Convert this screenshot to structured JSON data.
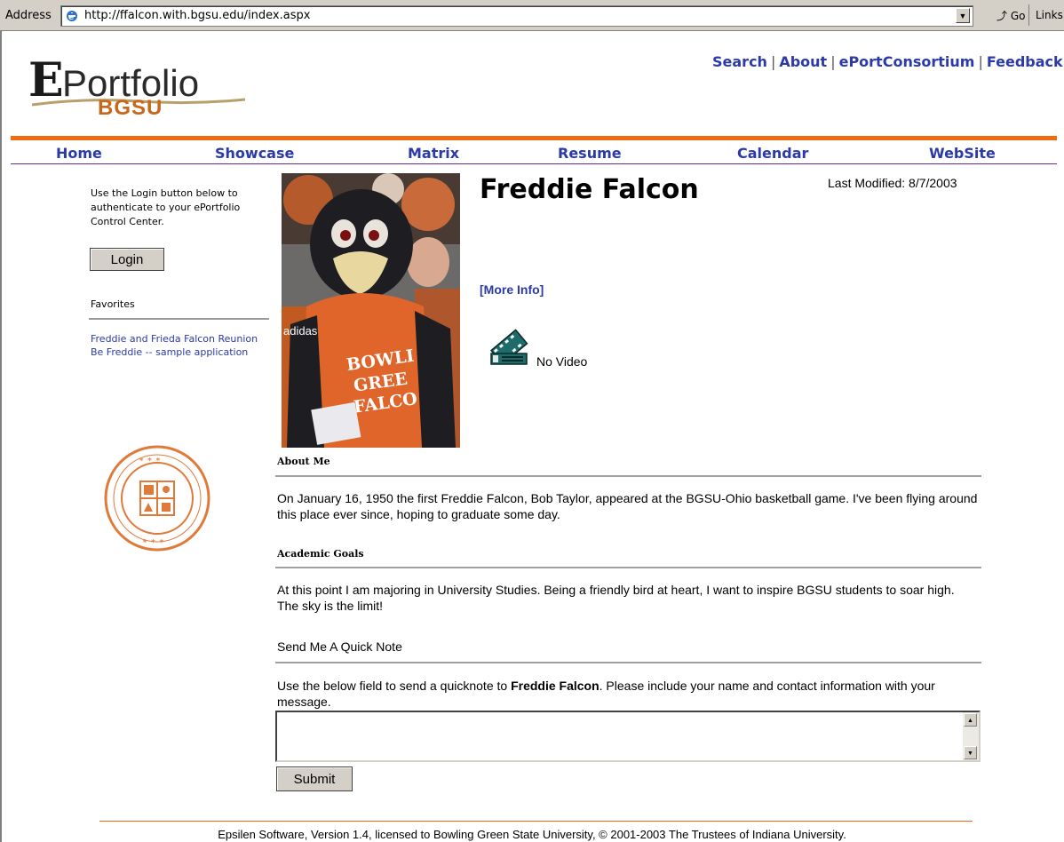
{
  "browser": {
    "address_label": "Address",
    "url": "http://ffalcon.with.bgsu.edu/index.aspx",
    "go_label": "Go",
    "links_label": "Links"
  },
  "logo": {
    "letter": "E",
    "word": "Portfolio",
    "school": "BGSU"
  },
  "top_links": [
    "Search",
    "About",
    "ePortConsortium",
    "Feedback"
  ],
  "top_links_separator": "|",
  "nav": [
    "Home",
    "Showcase",
    "Matrix",
    "Resume",
    "Calendar",
    "WebSite"
  ],
  "sidebar": {
    "login_text": "Use the Login button below to authenticate to your ePortfolio Control Center.",
    "login_button": "Login",
    "favorites_title": "Favorites",
    "favorites": [
      "Freddie and Frieda Falcon Reunion",
      "Be Freddie -- sample application"
    ]
  },
  "profile": {
    "name": "Freddie Falcon",
    "last_modified": "Last Modified: 8/7/2003",
    "more_info": "[More Info]",
    "video_status": "No Video"
  },
  "sections": {
    "about_title": "About Me",
    "about_body": "On January 16, 1950 the first Freddie Falcon, Bob Taylor, appeared at the BGSU-Ohio basketball game. I've been flying around this place ever since, hoping to graduate some day.",
    "goals_title": "Academic Goals",
    "goals_body": "At this point I am majoring in University Studies. Being a friendly bird at heart, I want to inspire BGSU students to soar high. The sky is the limit!"
  },
  "quicknote": {
    "title": "Send Me A Quick Note",
    "instructions_before": "Use the below field to send a quicknote to ",
    "instructions_name": "Freddie Falcon",
    "instructions_after": ". Please include your name and contact information with your message.",
    "message_value": "",
    "submit_label": "Submit"
  },
  "footer": "Epsilen Software, Version 1.4, licensed to Bowling Green State University, © 2001-2003 The Trustees of Indiana University.",
  "colors": {
    "link_blue": "#2b3aa8",
    "accent_orange": "#f06a10",
    "nav_line_purple": "#6b2b8e"
  }
}
